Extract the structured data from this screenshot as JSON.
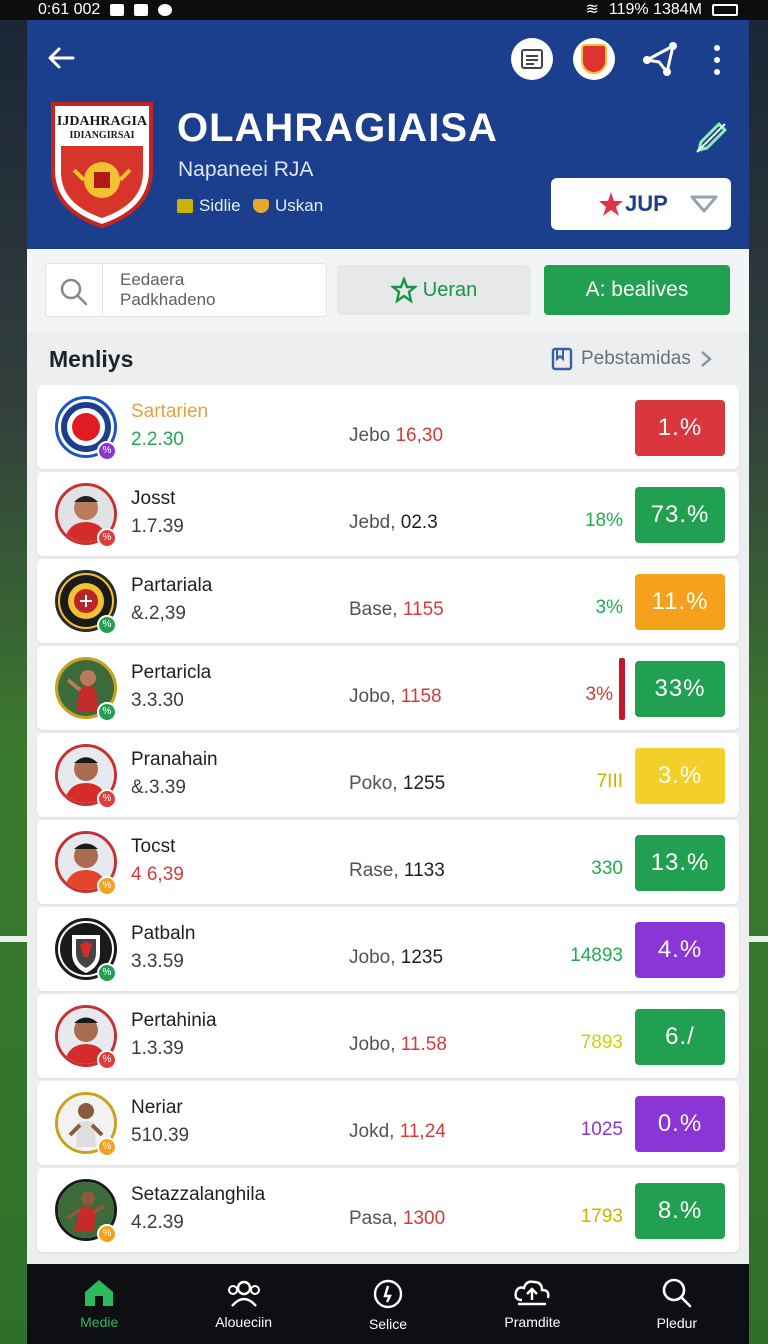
{
  "status_bar": {
    "time": "0:61 002",
    "right_text": "119% 1384M"
  },
  "header": {
    "team_name": "OLAHRAGIAISA",
    "subtitle": "Napaneei RJA",
    "crest_line1": "IJDAHRAGIA",
    "crest_line2": "IDIANGIRSAI",
    "tags": [
      {
        "label": "Sidlie",
        "icon": "jersey-icon",
        "color": "#c8b400"
      },
      {
        "label": "Uskan",
        "icon": "shield-icon",
        "color": "#e8a92b"
      }
    ],
    "dropdown_label": "JUP",
    "colors": {
      "header_bg": "#1b3f8d",
      "accent_green": "#22a052"
    }
  },
  "toolbar": {
    "search_line1": "Eedaera",
    "search_line2": "Padkhadeno",
    "filter_label": "Ueran",
    "primary_label": "A: bealives"
  },
  "section": {
    "title": "Menliys",
    "link_label": "Pebstamidas"
  },
  "rows": [
    {
      "name": "Sartarien",
      "sub": "2.2.30",
      "stat_label": "Jebo",
      "stat_value": "16,30",
      "small": "",
      "pill": "1.%",
      "pill_color": "#d9363e",
      "name_color": "#e8a13a",
      "sub_color": "#2aa655",
      "stat_color": "#d43b3b",
      "small_color": "#2aa655"
    },
    {
      "name": "Josst",
      "sub": "1.7.39",
      "stat_label": "Jebd,",
      "stat_value": "02.3",
      "small": "18%",
      "pill": "73.%",
      "pill_color": "#22a052",
      "name_color": "#1d1f22",
      "sub_color": "#3a3e43",
      "stat_color": "#1d1f22",
      "small_color": "#1fae4c"
    },
    {
      "name": "Partariala",
      "sub": "&.2,39",
      "stat_label": "Base,",
      "stat_value": "1155",
      "small": "3%",
      "pill": "11.%",
      "pill_color": "#f5a11b",
      "name_color": "#1d1f22",
      "sub_color": "#3a3e43",
      "stat_color": "#d43b3b",
      "small_color": "#1fae4c"
    },
    {
      "name": "Pertaricla",
      "sub": "3.3.30",
      "stat_label": "Jobo,",
      "stat_value": "1158",
      "small": "3%",
      "pill": "33%",
      "pill_color": "#22a052",
      "name_color": "#1d1f22",
      "sub_color": "#3a3e43",
      "stat_color": "#d43b3b",
      "small_color": "#d43b3b"
    },
    {
      "name": "Pranahain",
      "sub": "&.3.39",
      "stat_label": "Poko,",
      "stat_value": "1255",
      "small": "7III",
      "pill": "3.%",
      "pill_color": "#f3cf2a",
      "name_color": "#1d1f22",
      "sub_color": "#3a3e43",
      "stat_color": "#1d1f22",
      "small_color": "#c8b400"
    },
    {
      "name": "Tocst",
      "sub": "4 6,39",
      "stat_label": "Rase,",
      "stat_value": "1133",
      "small": "330",
      "pill": "13.%",
      "pill_color": "#22a052",
      "name_color": "#1d1f22",
      "sub_color": "#d43b3b",
      "stat_color": "#1d1f22",
      "small_color": "#1fae4c"
    },
    {
      "name": "Patbaln",
      "sub": "3.3.59",
      "stat_label": "Jobo,",
      "stat_value": "1235",
      "small": "14893",
      "pill": "4.%",
      "pill_color": "#8a35d6",
      "name_color": "#1d1f22",
      "sub_color": "#3a3e43",
      "stat_color": "#1d1f22",
      "small_color": "#1fae4c"
    },
    {
      "name": "Pertahinia",
      "sub": "1.3.39",
      "stat_label": "Jobo,",
      "stat_value": "11.58",
      "small": "7893",
      "pill": "6./",
      "pill_color": "#22a052",
      "name_color": "#1d1f22",
      "sub_color": "#3a3e43",
      "stat_color": "#d43b3b",
      "small_color": "#c8d400"
    },
    {
      "name": "Neriar",
      "sub": "510.39",
      "stat_label": "Jokd,",
      "stat_value": "11,24",
      "small": "1025",
      "pill": "0.%",
      "pill_color": "#8a35d6",
      "name_color": "#1d1f22",
      "sub_color": "#3a3e43",
      "stat_color": "#d43b3b",
      "small_color": "#8a35d6"
    },
    {
      "name": "Setazzalanghila",
      "sub": "4.2.39",
      "stat_label": "Pasa,",
      "stat_value": "1300",
      "small": "1793",
      "pill": "8.%",
      "pill_color": "#22a052",
      "name_color": "#1d1f22",
      "sub_color": "#3a3e43",
      "stat_color": "#d43b3b",
      "small_color": "#c8b400"
    }
  ],
  "bottom_nav": [
    {
      "label": "Medie",
      "icon": "home-icon",
      "active": true
    },
    {
      "label": "Aloueciin",
      "icon": "group-icon",
      "active": false
    },
    {
      "label": "Selice",
      "icon": "stopwatch-icon",
      "active": false
    },
    {
      "label": "Pramdite",
      "icon": "upload-icon",
      "active": false
    },
    {
      "label": "Pledur",
      "icon": "search-icon",
      "active": false
    }
  ]
}
